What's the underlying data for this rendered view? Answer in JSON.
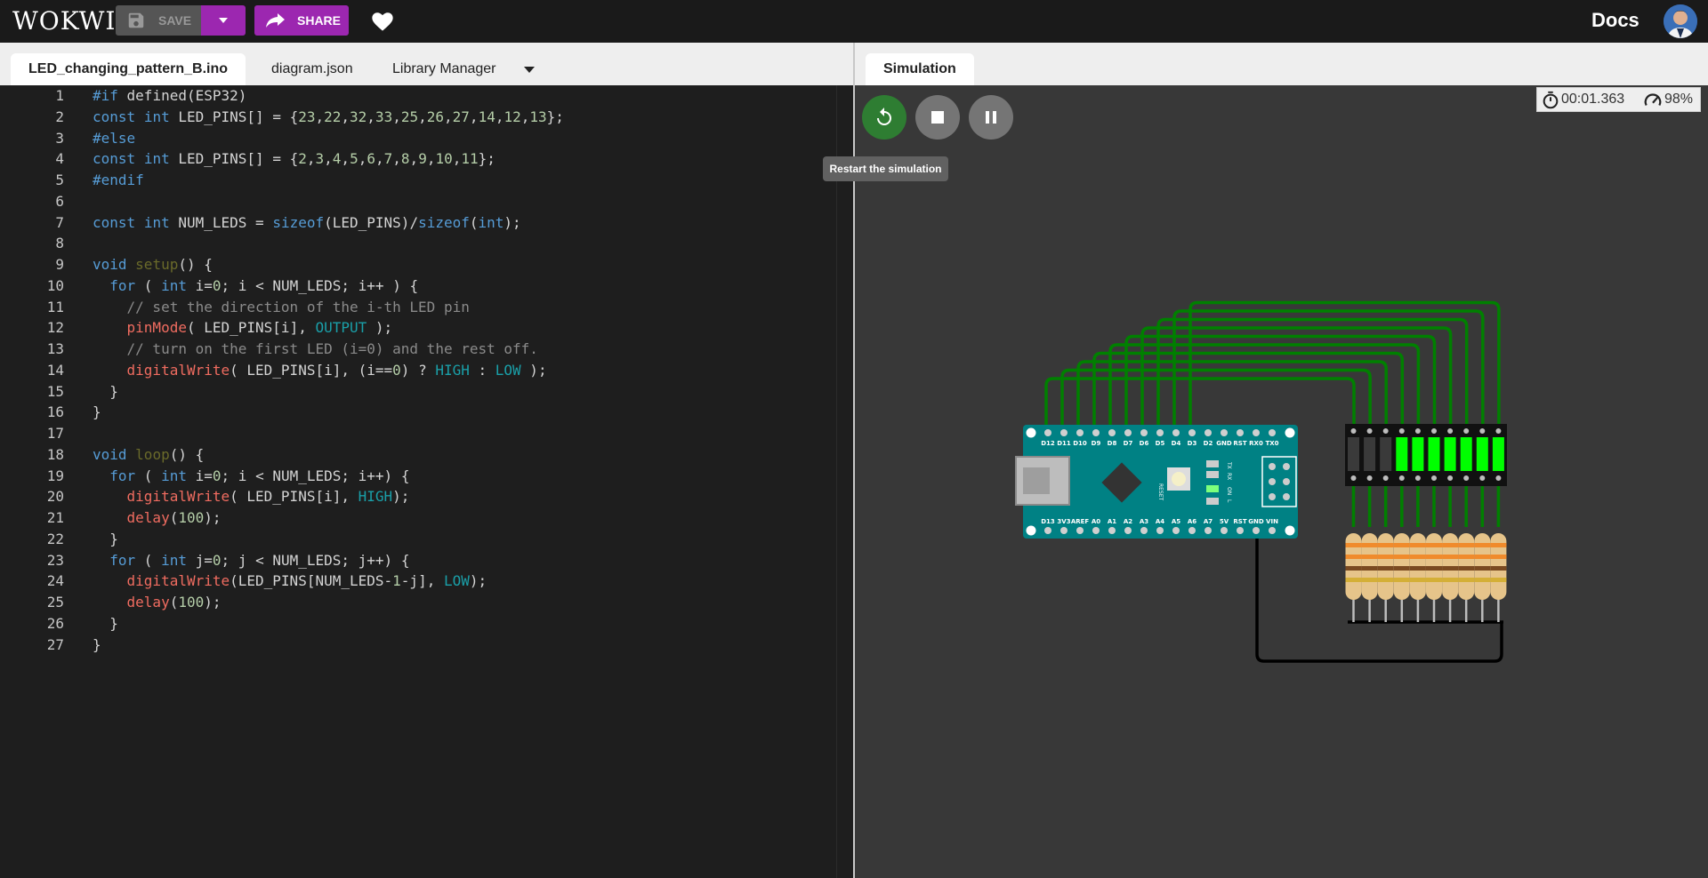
{
  "header": {
    "logo_text": "WOKWI",
    "save_label": "SAVE",
    "share_label": "SHARE",
    "docs_label": "Docs"
  },
  "editor": {
    "tabs": [
      {
        "label": "LED_changing_pattern_B.ino",
        "active": true
      },
      {
        "label": "diagram.json",
        "active": false
      },
      {
        "label": "Library Manager",
        "active": false
      }
    ],
    "lines": [
      {
        "num": "1",
        "tokens": [
          {
            "t": "#if",
            "c": "#569cd6"
          },
          {
            "t": " defined(ESP32)",
            "c": "#d4d4d4"
          }
        ]
      },
      {
        "num": "2",
        "tokens": [
          {
            "t": "const",
            "c": "#569cd6"
          },
          {
            "t": " ",
            "c": "#d4d4d4"
          },
          {
            "t": "int",
            "c": "#569cd6"
          },
          {
            "t": " LED_PINS[] = {",
            "c": "#d4d4d4"
          },
          {
            "t": "23",
            "c": "#b5cea8"
          },
          {
            "t": ",",
            "c": "#d4d4d4"
          },
          {
            "t": "22",
            "c": "#b5cea8"
          },
          {
            "t": ",",
            "c": "#d4d4d4"
          },
          {
            "t": "32",
            "c": "#b5cea8"
          },
          {
            "t": ",",
            "c": "#d4d4d4"
          },
          {
            "t": "33",
            "c": "#b5cea8"
          },
          {
            "t": ",",
            "c": "#d4d4d4"
          },
          {
            "t": "25",
            "c": "#b5cea8"
          },
          {
            "t": ",",
            "c": "#d4d4d4"
          },
          {
            "t": "26",
            "c": "#b5cea8"
          },
          {
            "t": ",",
            "c": "#d4d4d4"
          },
          {
            "t": "27",
            "c": "#b5cea8"
          },
          {
            "t": ",",
            "c": "#d4d4d4"
          },
          {
            "t": "14",
            "c": "#b5cea8"
          },
          {
            "t": ",",
            "c": "#d4d4d4"
          },
          {
            "t": "12",
            "c": "#b5cea8"
          },
          {
            "t": ",",
            "c": "#d4d4d4"
          },
          {
            "t": "13",
            "c": "#b5cea8"
          },
          {
            "t": "};",
            "c": "#d4d4d4"
          }
        ]
      },
      {
        "num": "3",
        "tokens": [
          {
            "t": "#else",
            "c": "#569cd6"
          }
        ]
      },
      {
        "num": "4",
        "tokens": [
          {
            "t": "const",
            "c": "#569cd6"
          },
          {
            "t": " ",
            "c": "#d4d4d4"
          },
          {
            "t": "int",
            "c": "#569cd6"
          },
          {
            "t": " LED_PINS[] = {",
            "c": "#d4d4d4"
          },
          {
            "t": "2",
            "c": "#b5cea8"
          },
          {
            "t": ",",
            "c": "#d4d4d4"
          },
          {
            "t": "3",
            "c": "#b5cea8"
          },
          {
            "t": ",",
            "c": "#d4d4d4"
          },
          {
            "t": "4",
            "c": "#b5cea8"
          },
          {
            "t": ",",
            "c": "#d4d4d4"
          },
          {
            "t": "5",
            "c": "#b5cea8"
          },
          {
            "t": ",",
            "c": "#d4d4d4"
          },
          {
            "t": "6",
            "c": "#b5cea8"
          },
          {
            "t": ",",
            "c": "#d4d4d4"
          },
          {
            "t": "7",
            "c": "#b5cea8"
          },
          {
            "t": ",",
            "c": "#d4d4d4"
          },
          {
            "t": "8",
            "c": "#b5cea8"
          },
          {
            "t": ",",
            "c": "#d4d4d4"
          },
          {
            "t": "9",
            "c": "#b5cea8"
          },
          {
            "t": ",",
            "c": "#d4d4d4"
          },
          {
            "t": "10",
            "c": "#b5cea8"
          },
          {
            "t": ",",
            "c": "#d4d4d4"
          },
          {
            "t": "11",
            "c": "#b5cea8"
          },
          {
            "t": "};",
            "c": "#d4d4d4"
          }
        ]
      },
      {
        "num": "5",
        "tokens": [
          {
            "t": "#endif",
            "c": "#569cd6"
          }
        ]
      },
      {
        "num": "6",
        "tokens": []
      },
      {
        "num": "7",
        "tokens": [
          {
            "t": "const",
            "c": "#569cd6"
          },
          {
            "t": " ",
            "c": "#d4d4d4"
          },
          {
            "t": "int",
            "c": "#569cd6"
          },
          {
            "t": " NUM_LEDS = ",
            "c": "#d4d4d4"
          },
          {
            "t": "sizeof",
            "c": "#569cd6"
          },
          {
            "t": "(LED_PINS)/",
            "c": "#d4d4d4"
          },
          {
            "t": "sizeof",
            "c": "#569cd6"
          },
          {
            "t": "(",
            "c": "#d4d4d4"
          },
          {
            "t": "int",
            "c": "#569cd6"
          },
          {
            "t": ");",
            "c": "#d4d4d4"
          }
        ]
      },
      {
        "num": "8",
        "tokens": []
      },
      {
        "num": "9",
        "tokens": [
          {
            "t": "void",
            "c": "#569cd6"
          },
          {
            "t": " ",
            "c": "#d4d4d4"
          },
          {
            "t": "setup",
            "c": "#6a6a2a"
          },
          {
            "t": "() {",
            "c": "#d4d4d4"
          }
        ]
      },
      {
        "num": "10",
        "tokens": [
          {
            "t": "  ",
            "c": "#d4d4d4"
          },
          {
            "t": "for",
            "c": "#569cd6"
          },
          {
            "t": " ( ",
            "c": "#d4d4d4"
          },
          {
            "t": "int",
            "c": "#569cd6"
          },
          {
            "t": " i=",
            "c": "#d4d4d4"
          },
          {
            "t": "0",
            "c": "#b5cea8"
          },
          {
            "t": "; i < NUM_LEDS; i++ ) {",
            "c": "#d4d4d4"
          }
        ]
      },
      {
        "num": "11",
        "tokens": [
          {
            "t": "    // set the direction of the i-th LED pin",
            "c": "#8a8a8a"
          }
        ]
      },
      {
        "num": "12",
        "tokens": [
          {
            "t": "    ",
            "c": "#d4d4d4"
          },
          {
            "t": "pinMode",
            "c": "#f06c60"
          },
          {
            "t": "( LED_PINS[i], ",
            "c": "#d4d4d4"
          },
          {
            "t": "OUTPUT",
            "c": "#1a9fa8"
          },
          {
            "t": " );",
            "c": "#d4d4d4"
          }
        ]
      },
      {
        "num": "13",
        "tokens": [
          {
            "t": "    // turn on the first LED (i=0) and the rest off.",
            "c": "#8a8a8a"
          }
        ]
      },
      {
        "num": "14",
        "tokens": [
          {
            "t": "    ",
            "c": "#d4d4d4"
          },
          {
            "t": "digitalWrite",
            "c": "#f06c60"
          },
          {
            "t": "( LED_PINS[i], (i==",
            "c": "#d4d4d4"
          },
          {
            "t": "0",
            "c": "#b5cea8"
          },
          {
            "t": ") ? ",
            "c": "#d4d4d4"
          },
          {
            "t": "HIGH",
            "c": "#1a9fa8"
          },
          {
            "t": " : ",
            "c": "#d4d4d4"
          },
          {
            "t": "LOW",
            "c": "#1a9fa8"
          },
          {
            "t": " );",
            "c": "#d4d4d4"
          }
        ]
      },
      {
        "num": "15",
        "tokens": [
          {
            "t": "  }",
            "c": "#d4d4d4"
          }
        ]
      },
      {
        "num": "16",
        "tokens": [
          {
            "t": "}",
            "c": "#d4d4d4"
          }
        ]
      },
      {
        "num": "17",
        "tokens": []
      },
      {
        "num": "18",
        "tokens": [
          {
            "t": "void",
            "c": "#569cd6"
          },
          {
            "t": " ",
            "c": "#d4d4d4"
          },
          {
            "t": "loop",
            "c": "#6a6a2a"
          },
          {
            "t": "() {",
            "c": "#d4d4d4"
          }
        ]
      },
      {
        "num": "19",
        "tokens": [
          {
            "t": "  ",
            "c": "#d4d4d4"
          },
          {
            "t": "for",
            "c": "#569cd6"
          },
          {
            "t": " ( ",
            "c": "#d4d4d4"
          },
          {
            "t": "int",
            "c": "#569cd6"
          },
          {
            "t": " i=",
            "c": "#d4d4d4"
          },
          {
            "t": "0",
            "c": "#b5cea8"
          },
          {
            "t": "; i < NUM_LEDS; i++) {",
            "c": "#d4d4d4"
          }
        ]
      },
      {
        "num": "20",
        "tokens": [
          {
            "t": "    ",
            "c": "#d4d4d4"
          },
          {
            "t": "digitalWrite",
            "c": "#f06c60"
          },
          {
            "t": "( LED_PINS[i], ",
            "c": "#d4d4d4"
          },
          {
            "t": "HIGH",
            "c": "#1a9fa8"
          },
          {
            "t": ");",
            "c": "#d4d4d4"
          }
        ]
      },
      {
        "num": "21",
        "tokens": [
          {
            "t": "    ",
            "c": "#d4d4d4"
          },
          {
            "t": "delay",
            "c": "#f06c60"
          },
          {
            "t": "(",
            "c": "#d4d4d4"
          },
          {
            "t": "100",
            "c": "#b5cea8"
          },
          {
            "t": ");",
            "c": "#d4d4d4"
          }
        ]
      },
      {
        "num": "22",
        "tokens": [
          {
            "t": "  }",
            "c": "#d4d4d4"
          }
        ]
      },
      {
        "num": "23",
        "tokens": [
          {
            "t": "  ",
            "c": "#d4d4d4"
          },
          {
            "t": "for",
            "c": "#569cd6"
          },
          {
            "t": " ( ",
            "c": "#d4d4d4"
          },
          {
            "t": "int",
            "c": "#569cd6"
          },
          {
            "t": " j=",
            "c": "#d4d4d4"
          },
          {
            "t": "0",
            "c": "#b5cea8"
          },
          {
            "t": "; j < NUM_LEDS; j++) {",
            "c": "#d4d4d4"
          }
        ]
      },
      {
        "num": "24",
        "tokens": [
          {
            "t": "    ",
            "c": "#d4d4d4"
          },
          {
            "t": "digitalWrite",
            "c": "#f06c60"
          },
          {
            "t": "(LED_PINS[NUM_LEDS-",
            "c": "#d4d4d4"
          },
          {
            "t": "1",
            "c": "#b5cea8"
          },
          {
            "t": "-j], ",
            "c": "#d4d4d4"
          },
          {
            "t": "LOW",
            "c": "#1a9fa8"
          },
          {
            "t": ");",
            "c": "#d4d4d4"
          }
        ]
      },
      {
        "num": "25",
        "tokens": [
          {
            "t": "    ",
            "c": "#d4d4d4"
          },
          {
            "t": "delay",
            "c": "#f06c60"
          },
          {
            "t": "(",
            "c": "#d4d4d4"
          },
          {
            "t": "100",
            "c": "#b5cea8"
          },
          {
            "t": ");",
            "c": "#d4d4d4"
          }
        ]
      },
      {
        "num": "26",
        "tokens": [
          {
            "t": "  }",
            "c": "#d4d4d4"
          }
        ]
      },
      {
        "num": "27",
        "tokens": [
          {
            "t": "}",
            "c": "#d4d4d4"
          }
        ]
      }
    ]
  },
  "simulation": {
    "tab_label": "Simulation",
    "tooltip": "Restart the simulation",
    "timer": "00:01.363",
    "speed": "98%",
    "board_pins_top": [
      "D12",
      "D11",
      "D10",
      "D9",
      "D8",
      "D7",
      "D6",
      "D5",
      "D4",
      "D3",
      "D2",
      "GND",
      "RST",
      "RX0",
      "TX0"
    ],
    "board_pins_bottom": [
      "D13",
      "3V3",
      "AREF",
      "A0",
      "A1",
      "A2",
      "A3",
      "A4",
      "A5",
      "A6",
      "A7",
      "5V",
      "RST",
      "GND",
      "VIN"
    ],
    "board_labels": [
      "RESET",
      "TX",
      "RX",
      "ON",
      "L"
    ],
    "led_states": [
      false,
      false,
      false,
      true,
      true,
      true,
      true,
      true,
      true,
      true
    ],
    "colors": {
      "accent": "#9c27b0",
      "wire": "#008000",
      "led_on": "#00ff00",
      "board": "#008184",
      "restart": "#2e7d32"
    }
  }
}
